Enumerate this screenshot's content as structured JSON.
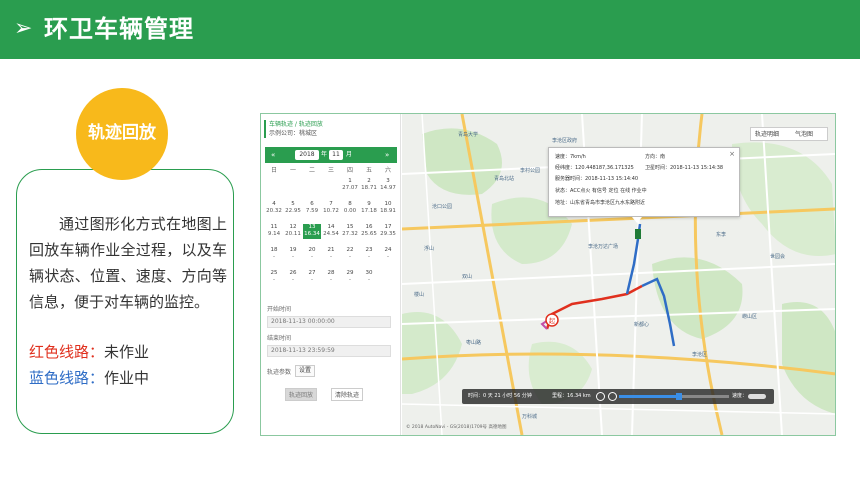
{
  "header": {
    "arrow": "➢",
    "title": "环卫车辆管理"
  },
  "badge": {
    "label": "轨迹回放"
  },
  "card": {
    "description": "通过图形化方式在地图上回放车辆作业全过程，以及车辆状态、位置、速度、方向等信息，便于对车辆的监控。",
    "legend_red_label": "红色线路：",
    "legend_red_value": "未作业",
    "legend_blue_label": "蓝色线路：",
    "legend_blue_value": "作业中"
  },
  "colors": {
    "brand_green": "#2a9d4f",
    "badge_yellow": "#f8b91b",
    "route_red": "#e0301e",
    "route_blue": "#2f6dc6"
  },
  "app": {
    "breadcrumb": "车辆轨迹 / 轨迹回放",
    "company": "示例公司：桃城区",
    "calendar": {
      "year": "2018",
      "year_suffix": "年",
      "month": "11",
      "month_suffix": "月",
      "prev": "«",
      "next": "»",
      "weekdays": [
        "日",
        "一",
        "二",
        "三",
        "四",
        "五",
        "六"
      ],
      "cells": [
        {
          "d": "",
          "v": ""
        },
        {
          "d": "",
          "v": ""
        },
        {
          "d": "",
          "v": ""
        },
        {
          "d": "",
          "v": ""
        },
        {
          "d": "1",
          "v": "27.07"
        },
        {
          "d": "2",
          "v": "18.71"
        },
        {
          "d": "3",
          "v": "14.97"
        },
        {
          "d": "4",
          "v": "20.32"
        },
        {
          "d": "5",
          "v": "22.95"
        },
        {
          "d": "6",
          "v": "7.59"
        },
        {
          "d": "7",
          "v": "10.72"
        },
        {
          "d": "8",
          "v": "0.00"
        },
        {
          "d": "9",
          "v": "17.18"
        },
        {
          "d": "10",
          "v": "18.91"
        },
        {
          "d": "11",
          "v": "9.14"
        },
        {
          "d": "12",
          "v": "20.11"
        },
        {
          "d": "13",
          "v": "16.34"
        },
        {
          "d": "14",
          "v": "24.54"
        },
        {
          "d": "15",
          "v": "27.32"
        },
        {
          "d": "16",
          "v": "25.65"
        },
        {
          "d": "17",
          "v": "29.35"
        },
        {
          "d": "18",
          "v": "-"
        },
        {
          "d": "19",
          "v": "-"
        },
        {
          "d": "20",
          "v": "-"
        },
        {
          "d": "21",
          "v": "-"
        },
        {
          "d": "22",
          "v": "-"
        },
        {
          "d": "23",
          "v": "-"
        },
        {
          "d": "24",
          "v": "-"
        },
        {
          "d": "25",
          "v": "-"
        },
        {
          "d": "26",
          "v": "-"
        },
        {
          "d": "27",
          "v": "-"
        },
        {
          "d": "28",
          "v": "-"
        },
        {
          "d": "29",
          "v": "-"
        },
        {
          "d": "30",
          "v": "-"
        },
        {
          "d": "",
          "v": ""
        }
      ],
      "selected_day": "13"
    },
    "start_label": "开始时间",
    "start_value": "2018-11-13 00:00:00",
    "end_label": "结束时间",
    "end_value": "2018-11-13 23:59:59",
    "speed_label": "轨迹参数",
    "speed_button": "设置",
    "btn_search": "轨迹回放",
    "btn_export": "清除轨迹",
    "map": {
      "layers": [
        "轨迹明细",
        "气泡图"
      ],
      "popup": {
        "speed": "速度：7km/h",
        "direction": "方向：南",
        "coords": "经纬度：120.448187,36.171325",
        "gps_time": "卫星时间：2018-11-13 15:14:38",
        "server_time": "服务器时间：2018-11-13 15:14:40",
        "status": "状态：ACC点火 有信号 定位 在线 作业中",
        "address": "地址：山东省青岛市李沧区九水东路附近",
        "close": "×"
      },
      "labels": [
        "青岛大学",
        "李村公园",
        "李沧区政府",
        "中韩街道",
        "李沧万达广场",
        "青岛北站",
        "东李",
        "九水",
        "浮山",
        "沧口公园",
        "崂山区",
        "世园会",
        "双山",
        "海尔路",
        "枣山路",
        "新都心",
        "楼山",
        "李沧区",
        "万科城"
      ],
      "player": {
        "time": "时间：0 天 21 小时 56 分钟",
        "distance": "里程：16.34 km",
        "speed_label": "速度："
      },
      "copyright": "© 2018 AutoNavi - GS(2018)1709号 高德地图"
    }
  }
}
